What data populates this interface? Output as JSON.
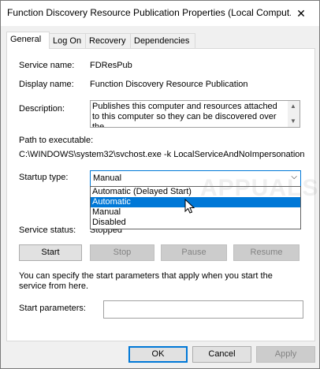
{
  "window": {
    "title": "Function Discovery Resource Publication Properties (Local Comput...",
    "close_glyph": "✕"
  },
  "tabs": [
    {
      "label": "General",
      "active": true
    },
    {
      "label": "Log On",
      "active": false
    },
    {
      "label": "Recovery",
      "active": false
    },
    {
      "label": "Dependencies",
      "active": false
    }
  ],
  "general": {
    "service_name_label": "Service name:",
    "service_name": "FDResPub",
    "display_name_label": "Display name:",
    "display_name": "Function Discovery Resource Publication",
    "description_label": "Description:",
    "description": "Publishes this computer and resources attached to this computer so they can be discovered over the",
    "path_label": "Path to executable:",
    "path": "C:\\WINDOWS\\system32\\svchost.exe -k LocalServiceAndNoImpersonation",
    "startup_type_label": "Startup type:",
    "startup_type": "Manual",
    "startup_options": [
      "Automatic (Delayed Start)",
      "Automatic",
      "Manual",
      "Disabled"
    ],
    "highlighted_option": "Automatic",
    "service_status_label": "Service status:",
    "service_status": "Stopped",
    "buttons": {
      "start": "Start",
      "stop": "Stop",
      "pause": "Pause",
      "resume": "Resume"
    },
    "hint": "You can specify the start parameters that apply when you start the service from here.",
    "start_params_label": "Start parameters:",
    "start_params_value": ""
  },
  "footer": {
    "ok": "OK",
    "cancel": "Cancel",
    "apply": "Apply"
  },
  "watermark": "APPUALS",
  "colors": {
    "accent": "#0078d7",
    "disabled_text": "#838383"
  }
}
